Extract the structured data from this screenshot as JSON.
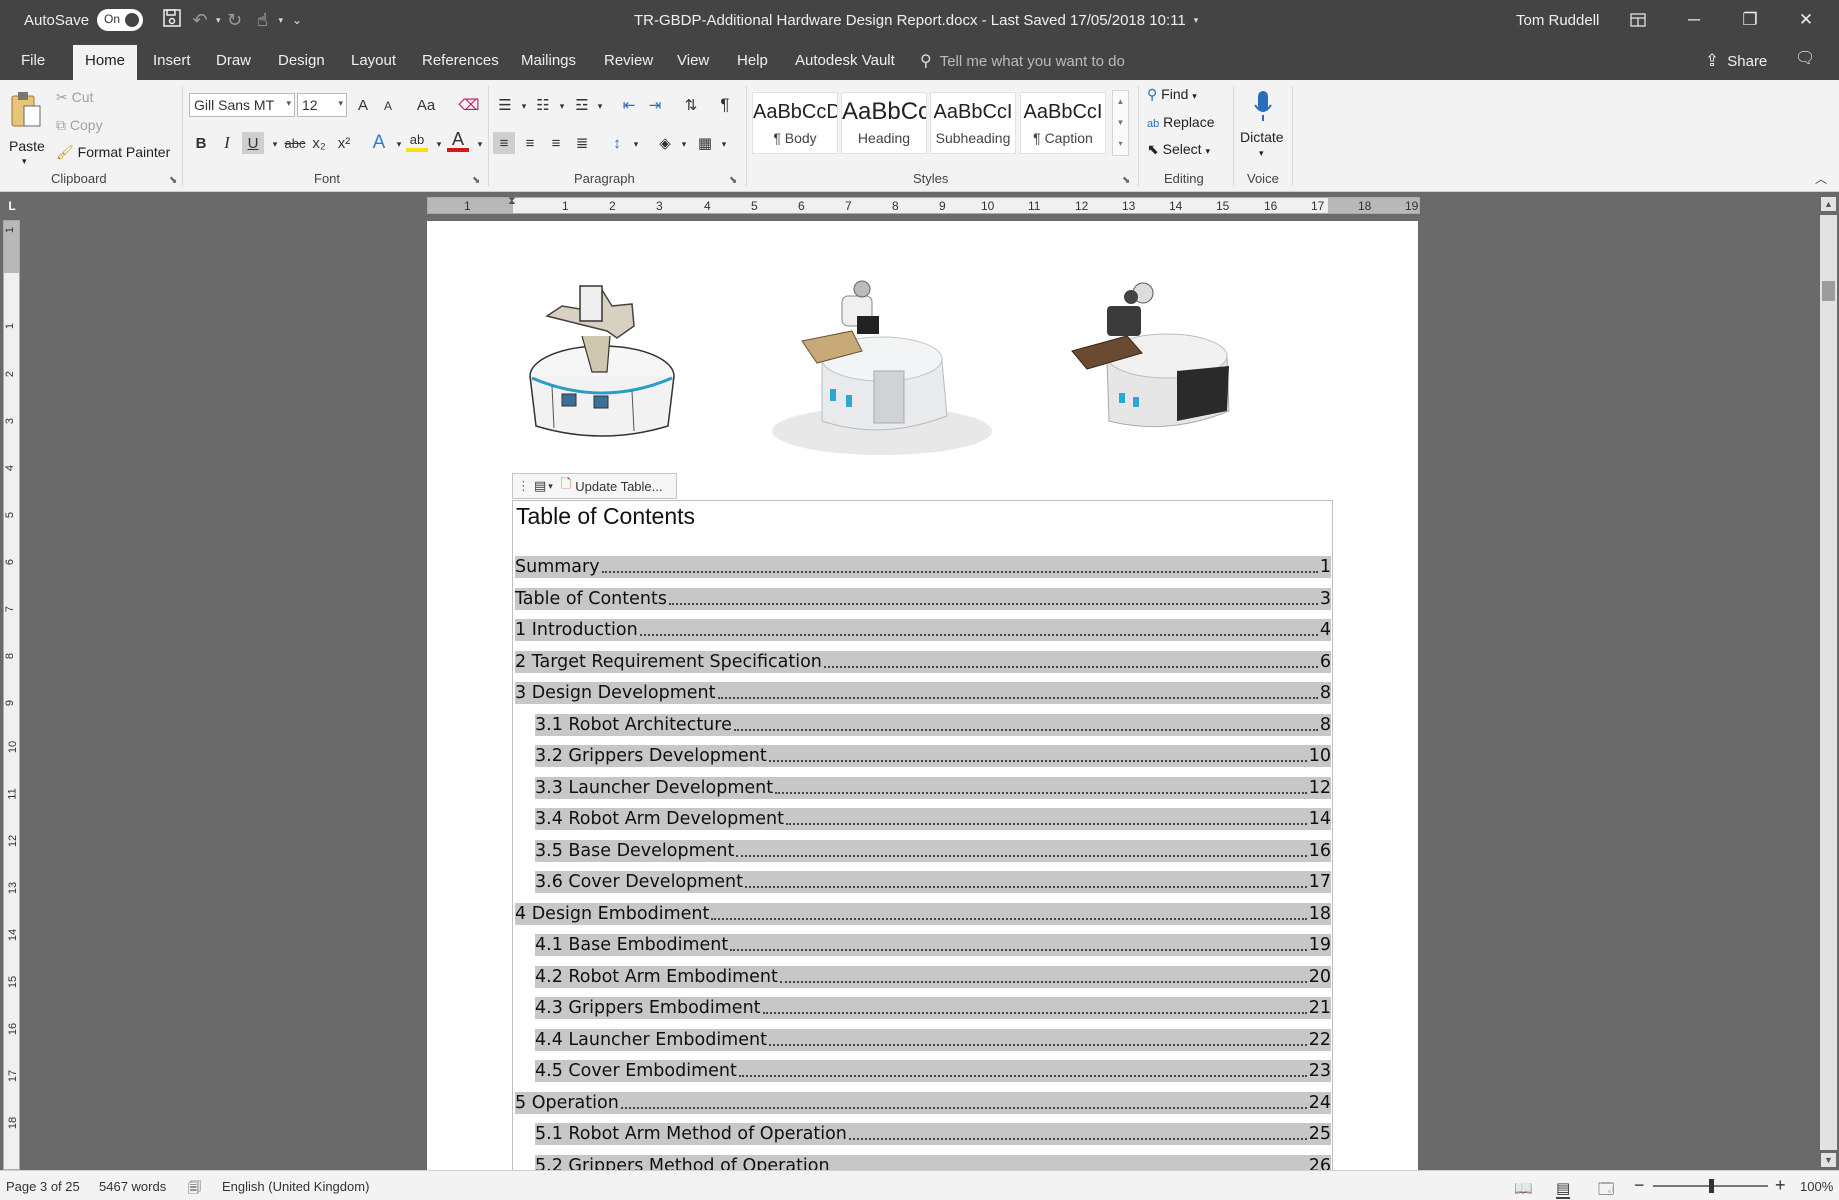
{
  "titlebar": {
    "autosave_label": "AutoSave",
    "autosave_state": "On",
    "document_title": "TR-GBDP-Additional Hardware Design Report.docx  -  Last Saved 17/05/2018 10:11",
    "user_name": "Tom Ruddell"
  },
  "tabs": [
    "File",
    "Home",
    "Insert",
    "Draw",
    "Design",
    "Layout",
    "References",
    "Mailings",
    "Review",
    "View",
    "Help",
    "Autodesk Vault"
  ],
  "active_tab": "Home",
  "tell_me_placeholder": "Tell me what you want to do",
  "share_label": "Share",
  "ribbon": {
    "clipboard": {
      "paste": "Paste",
      "cut": "Cut",
      "copy": "Copy",
      "format_painter": "Format Painter",
      "group": "Clipboard"
    },
    "font": {
      "name": "Gill Sans MT",
      "size": "12",
      "group": "Font",
      "change_case": "Aa",
      "grow": "A",
      "shrink": "A",
      "bold": "B",
      "italic": "I",
      "underline": "U",
      "strike": "abc",
      "sub": "x₂",
      "sup": "x²",
      "effects": "A",
      "highlight": "ab",
      "color": "A",
      "highlight_color": "#f5e10d",
      "font_color": "#d11b1b"
    },
    "paragraph": {
      "group": "Paragraph"
    },
    "styles": {
      "group": "Styles",
      "items": [
        {
          "preview": "AaBbCcD",
          "name": "¶ Body"
        },
        {
          "preview": "AaBbCc",
          "name": "Heading"
        },
        {
          "preview": "AaBbCcI",
          "name": "Subheading"
        },
        {
          "preview": "AaBbCcI",
          "name": "¶ Caption"
        }
      ]
    },
    "editing": {
      "find": "Find",
      "replace": "Replace",
      "select": "Select",
      "group": "Editing"
    },
    "voice": {
      "dictate": "Dictate",
      "group": "Voice"
    }
  },
  "ruler": {
    "h_numbers": [
      "1",
      "1",
      "2",
      "3",
      "4",
      "5",
      "6",
      "7",
      "8",
      "9",
      "10",
      "11",
      "12",
      "13",
      "14",
      "15",
      "16",
      "17",
      "18",
      "19"
    ],
    "v_numbers": [
      "1",
      "1",
      "2",
      "3",
      "4",
      "5",
      "6",
      "7",
      "8",
      "9",
      "10",
      "11",
      "12",
      "13",
      "14",
      "15",
      "16",
      "17",
      "18"
    ]
  },
  "toc_toolbar": {
    "update_label": "Update Table..."
  },
  "toc": {
    "title": "Table of Contents",
    "entries": [
      {
        "label": "Summary",
        "page": "1",
        "level": 1
      },
      {
        "label": "Table of Contents",
        "page": "3",
        "level": 1
      },
      {
        "label": "1 Introduction",
        "page": "4",
        "level": 1
      },
      {
        "label": "2 Target Requirement Specification",
        "page": "6",
        "level": 1
      },
      {
        "label": "3 Design Development",
        "page": "8",
        "level": 1
      },
      {
        "label": "3.1 Robot Architecture",
        "page": "8",
        "level": 2
      },
      {
        "label": "3.2 Grippers Development",
        "page": "10",
        "level": 2
      },
      {
        "label": "3.3 Launcher Development",
        "page": "12",
        "level": 2
      },
      {
        "label": "3.4 Robot Arm Development",
        "page": "14",
        "level": 2
      },
      {
        "label": "3.5 Base Development",
        "page": "16",
        "level": 2
      },
      {
        "label": "3.6 Cover Development",
        "page": "17",
        "level": 2
      },
      {
        "label": "4 Design Embodiment",
        "page": "18",
        "level": 1
      },
      {
        "label": "4.1 Base Embodiment",
        "page": "19",
        "level": 2
      },
      {
        "label": "4.2 Robot Arm Embodiment",
        "page": "20",
        "level": 2
      },
      {
        "label": "4.3 Grippers Embodiment",
        "page": "21",
        "level": 2
      },
      {
        "label": "4.4 Launcher Embodiment",
        "page": "22",
        "level": 2
      },
      {
        "label": "4.5 Cover Embodiment",
        "page": "23",
        "level": 2
      },
      {
        "label": "5 Operation",
        "page": "24",
        "level": 1
      },
      {
        "label": "5.1 Robot Arm Method of Operation",
        "page": "25",
        "level": 2
      },
      {
        "label": "5.2 Grippers Method of Operation",
        "page": "26",
        "level": 2
      }
    ]
  },
  "statusbar": {
    "page": "Page 3 of 25",
    "words": "5467 words",
    "language": "English (United Kingdom)",
    "zoom": "100%"
  }
}
